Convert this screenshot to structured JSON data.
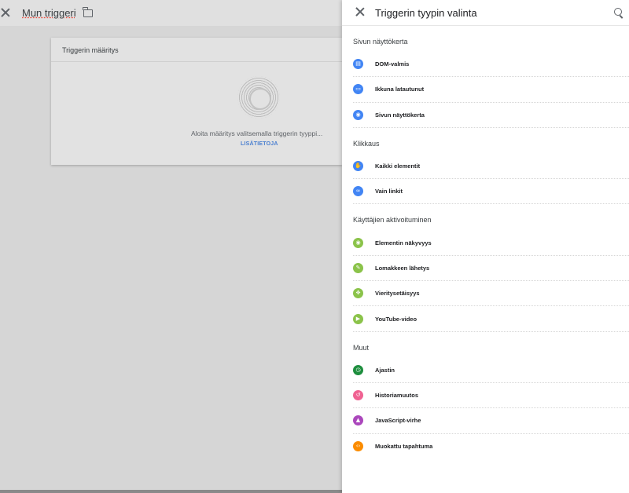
{
  "editor": {
    "title": "Mun triggeri",
    "card": {
      "title": "Triggerin määritys",
      "hint": "Aloita määritys valitsemalla triggerin tyyppi...",
      "link": "LISÄTIETOJA"
    }
  },
  "panel": {
    "title": "Triggerin tyypin valinta",
    "sections": [
      {
        "title": "Sivun näyttökerta",
        "items": [
          {
            "label": "DOM-valmis",
            "icon": "document-icon",
            "color": "#4285f4",
            "glyph": "▤"
          },
          {
            "label": "Ikkuna latautunut",
            "icon": "window-icon",
            "color": "#4285f4",
            "glyph": "▭"
          },
          {
            "label": "Sivun näyttökerta",
            "icon": "eye-icon",
            "color": "#4285f4",
            "glyph": "◉"
          }
        ]
      },
      {
        "title": "Klikkaus",
        "items": [
          {
            "label": "Kaikki elementit",
            "icon": "hand-pointer-icon",
            "color": "#4285f4",
            "glyph": "✋"
          },
          {
            "label": "Vain linkit",
            "icon": "link-icon",
            "color": "#4285f4",
            "glyph": "∞"
          }
        ]
      },
      {
        "title": "Käyttäjien aktivoituminen",
        "items": [
          {
            "label": "Elementin näkyvyys",
            "icon": "eye-icon",
            "color": "#8bc34a",
            "glyph": "◉"
          },
          {
            "label": "Lomakkeen lähetys",
            "icon": "form-icon",
            "color": "#8bc34a",
            "glyph": "✎"
          },
          {
            "label": "Vieritysetäisyys",
            "icon": "scroll-arrows-icon",
            "color": "#8bc34a",
            "glyph": "✥"
          },
          {
            "label": "YouTube-video",
            "icon": "play-icon",
            "color": "#8bc34a",
            "glyph": "▶"
          }
        ]
      },
      {
        "title": "Muut",
        "items": [
          {
            "label": "Ajastin",
            "icon": "timer-icon",
            "color": "#1e8e3e",
            "glyph": "◷"
          },
          {
            "label": "Historiamuutos",
            "icon": "history-icon",
            "color": "#f06292",
            "glyph": "↺"
          },
          {
            "label": "JavaScript-virhe",
            "icon": "warning-icon",
            "color": "#ab47bc",
            "glyph": "▲"
          },
          {
            "label": "Muokattu tapahtuma",
            "icon": "code-icon",
            "color": "#fb8c00",
            "glyph": "‹›"
          }
        ]
      }
    ]
  }
}
